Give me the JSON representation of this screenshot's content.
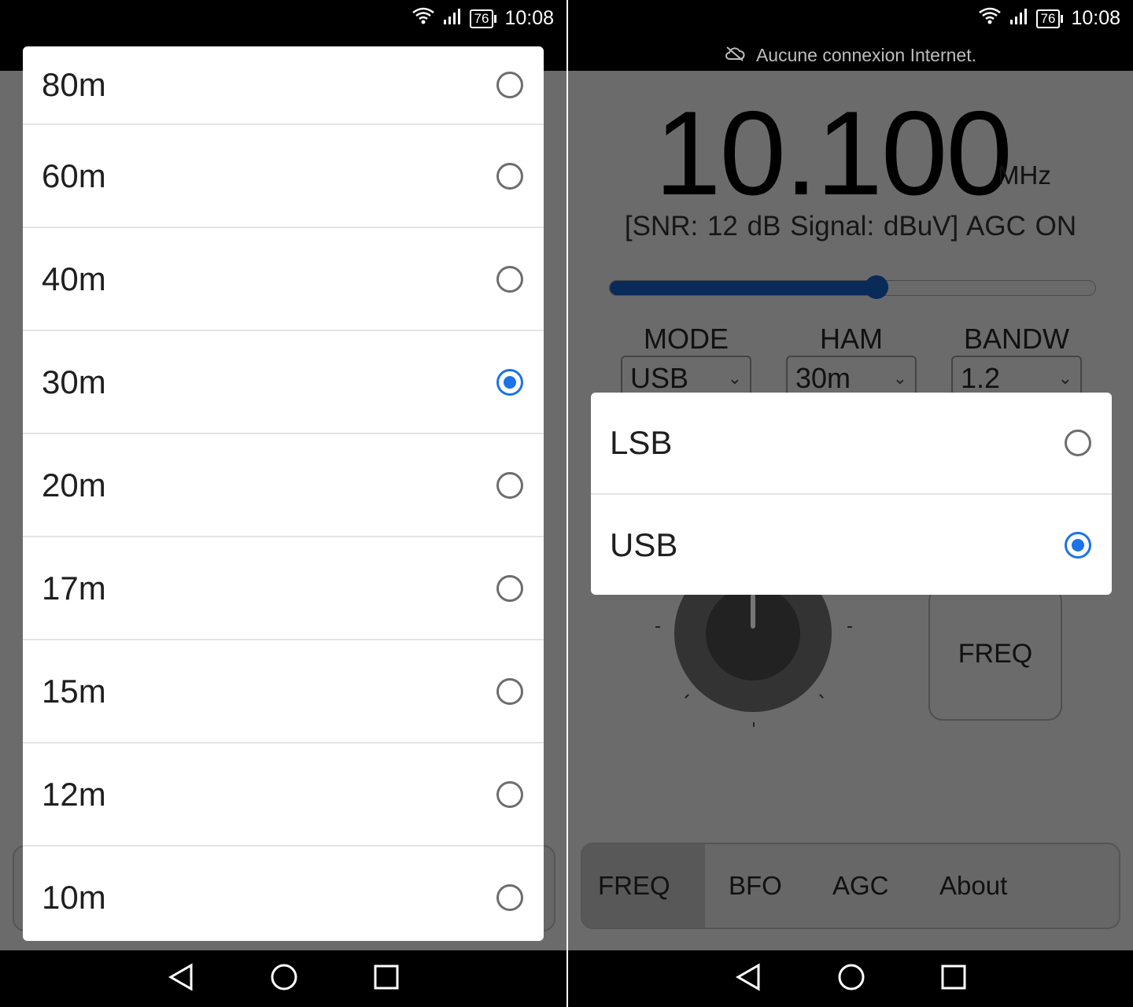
{
  "status": {
    "battery": "76",
    "time": "10:08"
  },
  "left": {
    "bands": [
      {
        "label": "80m",
        "selected": false
      },
      {
        "label": "60m",
        "selected": false
      },
      {
        "label": "40m",
        "selected": false
      },
      {
        "label": "30m",
        "selected": true
      },
      {
        "label": "20m",
        "selected": false
      },
      {
        "label": "17m",
        "selected": false
      },
      {
        "label": "15m",
        "selected": false
      },
      {
        "label": "12m",
        "selected": false
      },
      {
        "label": "10m",
        "selected": false
      }
    ]
  },
  "right": {
    "offline_text": "Aucune connexion Internet.",
    "frequency": {
      "value": "10.100",
      "unit": "MHz"
    },
    "snr_line": "[SNR:  12 dB Signal:   dBuV] AGC ON",
    "volume_slider": {
      "value": 0.55
    },
    "selectors": [
      {
        "label": "MODE",
        "value": "USB"
      },
      {
        "label": "HAM",
        "value": "30m"
      },
      {
        "label": "BANDW",
        "value": "1.2"
      }
    ],
    "freq_button": "FREQ",
    "tabs": [
      {
        "label": "FREQ",
        "active": true
      },
      {
        "label": "BFO",
        "active": false
      },
      {
        "label": "AGC",
        "active": false
      },
      {
        "label": "About",
        "active": false
      }
    ],
    "mode_options": [
      {
        "label": "LSB",
        "selected": false
      },
      {
        "label": "USB",
        "selected": true
      }
    ]
  },
  "colors": {
    "accent": "#1a73e8",
    "slider_fill": "#0a2a5a",
    "scrim": "#6b6b6b"
  },
  "icons": [
    "wifi-icon",
    "signal-icon",
    "battery-icon",
    "cloud-off-icon",
    "back-icon",
    "home-icon",
    "recents-icon",
    "chevron-down-icon"
  ]
}
